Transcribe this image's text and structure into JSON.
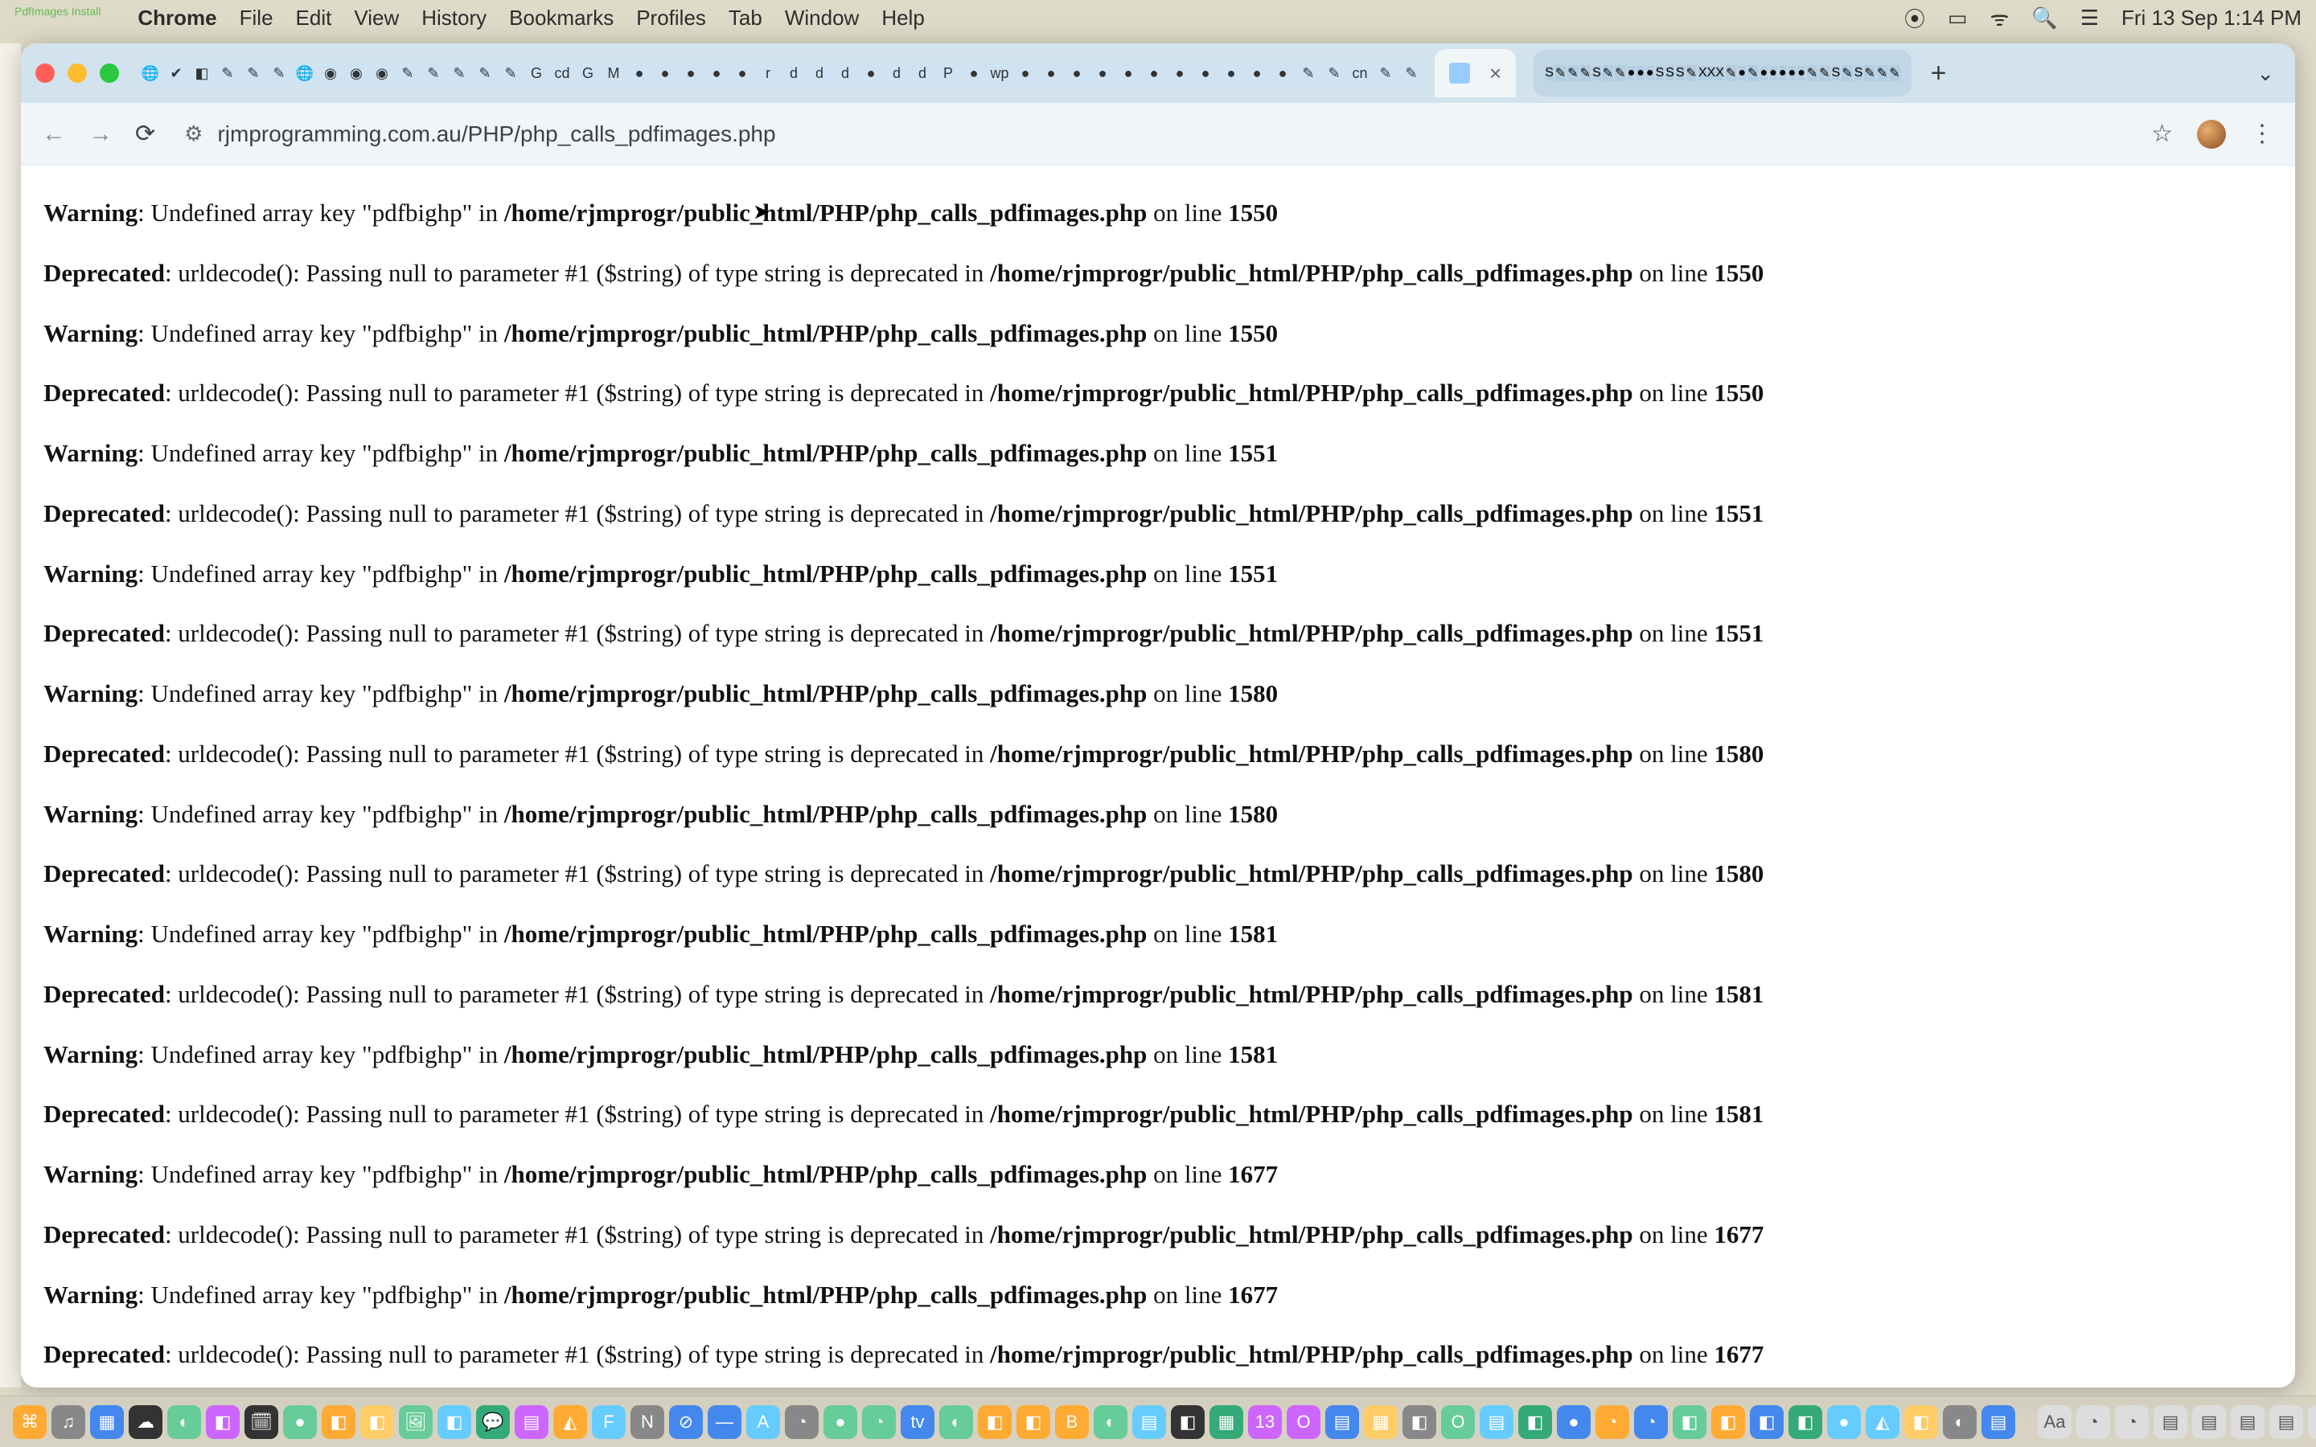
{
  "menubar": {
    "tiny_label": "PdfImages Install",
    "app": "Chrome",
    "items": [
      "File",
      "Edit",
      "View",
      "History",
      "Bookmarks",
      "Profiles",
      "Tab",
      "Window",
      "Help"
    ],
    "clock": "Fri 13 Sep  1:14 PM"
  },
  "browser": {
    "url": "rjmprogramming.com.au/PHP/php_calls_pdfimages.php",
    "tab_close": "×",
    "new_tab": "+",
    "caret": "⌄"
  },
  "icons": {
    "apple": "",
    "screenrec": "⦿",
    "battery": "▭",
    "wifi": "ᯤ",
    "search": "🔍",
    "control": "☰",
    "back": "←",
    "forward": "→",
    "reload": "⟳",
    "site": "≣",
    "tune": "⚙",
    "star": "☆",
    "kebab": "⋮"
  },
  "messages": {
    "warning_label": "Warning",
    "deprecated_label": "Deprecated",
    "warning_body": ": Undefined array key \"pdfbighp\" in ",
    "deprecated_body": ": urldecode(): Passing null to parameter #1 ($string) of type string is deprecated in ",
    "on_line": " on line ",
    "file": "/home/rjmprogr/public_html/PHP/php_calls_pdfimages.php",
    "lines": {
      "w0": "1550",
      "d0": "1550",
      "w1": "1550",
      "d1": "1550",
      "w2": "1551",
      "d2": "1551",
      "w3": "1551",
      "d3": "1551",
      "w4": "1580",
      "d4": "1580",
      "w5": "1580",
      "d5": "1580",
      "w6": "1581",
      "d6": "1581",
      "w7": "1581",
      "d7": "1581",
      "w8": "1677",
      "d8": "1677",
      "w9": "1677",
      "d9": "1677"
    }
  },
  "favicons_left": [
    "🌐",
    "✔",
    "◧",
    "✎",
    "✎",
    "✎",
    "🌐",
    "◉",
    "◉",
    "◉",
    "✎",
    "✎",
    "✎",
    "✎",
    "✎",
    "G",
    "cd",
    "G",
    "M",
    "●",
    "●",
    "●",
    "●",
    "●",
    "r",
    "d",
    "d",
    "d",
    "●",
    "d",
    "d",
    "P",
    "●",
    "wp",
    "●",
    "●",
    "●",
    "●",
    "●",
    "●",
    "●",
    "●",
    "●",
    "●",
    "●",
    "✎",
    "✎",
    "cn",
    "✎",
    "✎"
  ],
  "favicons_right": [
    "S",
    "✎",
    "✎",
    "✎",
    "S",
    "✎",
    "✎",
    "●",
    "●",
    "●",
    "S",
    "S",
    "S",
    "✎",
    "XXX",
    "✎",
    "●",
    "✎",
    "●",
    "●",
    "●",
    "●",
    "●",
    "✎",
    "✎",
    "S",
    "✎",
    "S",
    "✎",
    "✎",
    "✎"
  ],
  "dock_icons": [
    "⌘",
    "♫",
    "▦",
    "☁",
    "◐",
    "◧",
    "🗓",
    "●",
    "◧",
    "◧",
    "🖼",
    "◧",
    "💬",
    "▤",
    "◭",
    "F",
    "N",
    "⊘",
    "—",
    "A",
    "◔",
    "●",
    "◔",
    "tv",
    "◐",
    "◧",
    "◧",
    "B",
    "◐",
    "▤",
    "◧",
    "▦",
    "13",
    "O",
    "▤",
    "▦",
    "◧",
    "O",
    "▤",
    "◧",
    "●",
    "◔",
    "◔",
    "◧",
    "◧",
    "◧",
    "◧",
    "●",
    "◭",
    "◧",
    "◐",
    "▤"
  ],
  "dock_right": [
    "Aa",
    "◔",
    "◔",
    "▤",
    "▤",
    "▤",
    "▤",
    "▤",
    "▤",
    "▤",
    "▤",
    "▤",
    "▤"
  ]
}
